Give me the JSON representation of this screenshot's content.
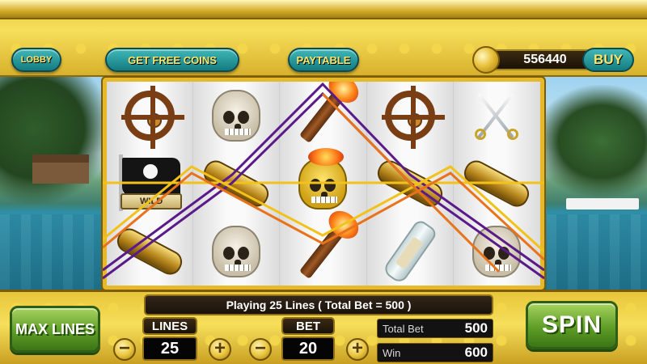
{
  "header": {
    "lobby_label": "LOBBY",
    "free_coins_label": "GET FREE COINS",
    "paytable_label": "PAYTABLE",
    "coins": "556440",
    "buy_label": "BUY"
  },
  "reels": {
    "wild_label": "WILD",
    "symbols": [
      [
        "ship-wheel",
        "pirate-flag-wild",
        "spyglass"
      ],
      [
        "skull",
        "spyglass",
        "skull"
      ],
      [
        "torch",
        "gold-skull",
        "torch"
      ],
      [
        "ship-wheel",
        "spyglass",
        "bottle"
      ],
      [
        "crossed-swords",
        "spyglass",
        "skull"
      ]
    ]
  },
  "controls": {
    "status_text": "Playing 25 Lines ( Total Bet = 500 )",
    "max_lines_label": "MAX LINES",
    "lines_label": "LINES",
    "lines_value": "25",
    "bet_label": "BET",
    "bet_value": "20",
    "minus": "−",
    "plus": "+",
    "total_bet_label": "Total Bet",
    "total_bet_value": "500",
    "win_label": "Win",
    "win_value": "600",
    "spin_label": "SPIN"
  },
  "colors": {
    "gold": "#e8c53a",
    "teal_button": "#157b80",
    "green_button": "#5f9e27",
    "payline_purple": "#5a1a8a",
    "payline_gold": "#f2c21b",
    "payline_orange": "#e8731a"
  }
}
